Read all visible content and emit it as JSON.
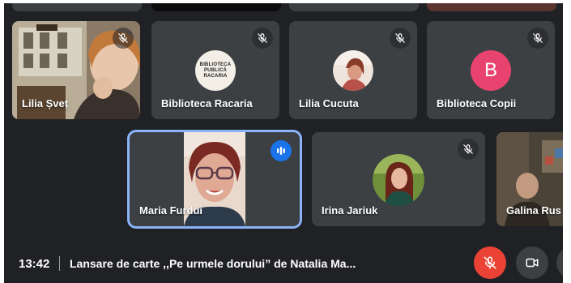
{
  "meeting": {
    "time": "13:42",
    "title": "Lansare de carte ,,Pe urmele dorului” de Natalia Ma..."
  },
  "participants": [
    {
      "name": "Lilia Șveț",
      "muted": true,
      "avatar": "video"
    },
    {
      "name": "Biblioteca Racaria",
      "muted": true,
      "avatar": "logo",
      "logo_text": [
        "BIBLIOTECA",
        "PUBLICĂ",
        "RACARIA"
      ]
    },
    {
      "name": "Lilia Cucuta",
      "muted": true,
      "avatar": "photo"
    },
    {
      "name": "Biblioteca Copii",
      "muted": true,
      "avatar": "letter",
      "letter": "B"
    },
    {
      "name": "Maria Furdui",
      "muted": false,
      "speaking": true,
      "avatar": "video"
    },
    {
      "name": "Irina Jariuk",
      "muted": true,
      "avatar": "photo"
    },
    {
      "name": "Galina Rus",
      "muted": false,
      "avatar": "video"
    }
  ],
  "colors": {
    "background": "#202124",
    "tile": "#3c4043",
    "active_border": "#8ab4f8",
    "speaking": "#1a73e8",
    "mic_off_button": "#ea4335",
    "letter_avatar": "#e8436f"
  },
  "icons": {
    "muted": "mic-off-icon",
    "speaking": "audio-levels-icon",
    "mic_button": "mic-off-icon",
    "camera_button": "video-camera-icon"
  }
}
